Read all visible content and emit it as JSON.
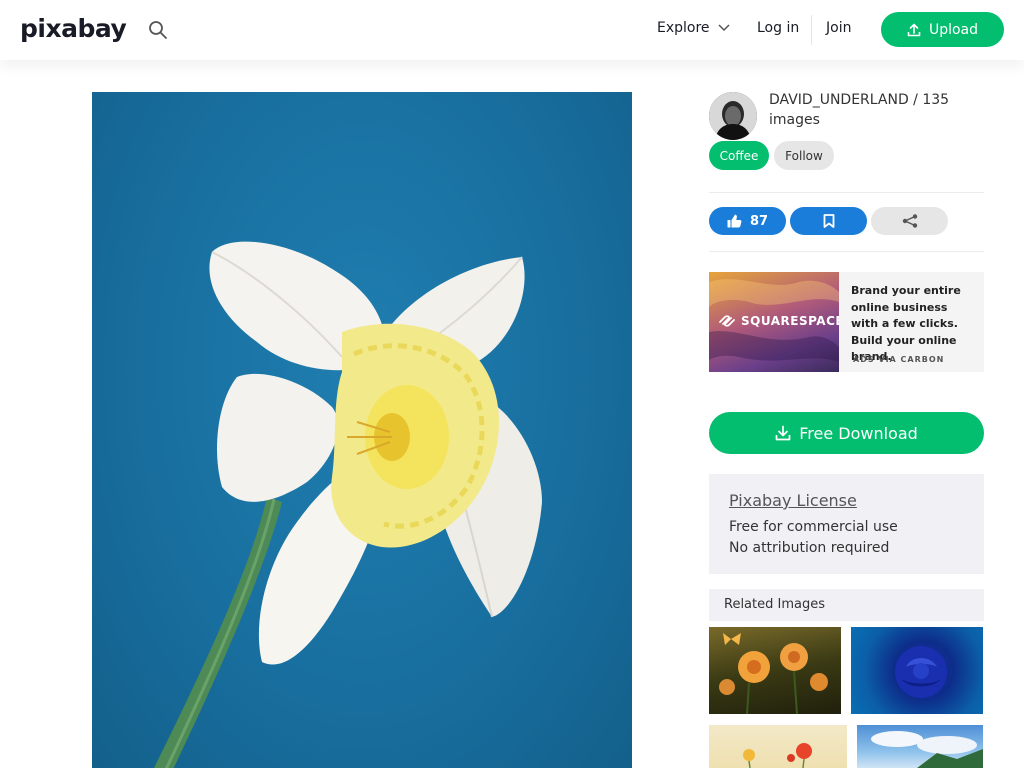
{
  "header": {
    "logo": "pixabay",
    "nav_explore": "Explore",
    "nav_login": "Log in",
    "nav_join": "Join",
    "upload_label": "Upload"
  },
  "author": {
    "name_line": "DAVID_UNDERLAND / 135 images",
    "coffee_label": "Coffee",
    "follow_label": "Follow"
  },
  "actions": {
    "like_count": "87"
  },
  "ad": {
    "brand": "SQUARESPACE",
    "text": "Brand your entire online business with a few clicks. Build your online brand.",
    "via": "ADS VIA CARBON"
  },
  "download": {
    "label": "Free Download"
  },
  "license": {
    "title": "Pixabay License",
    "line1": "Free for commercial use",
    "line2": "No attribution required"
  },
  "related": {
    "heading": "Related Images"
  },
  "colors": {
    "brand_green": "#02be6e",
    "action_blue": "#1a7dda",
    "photo_background": "#186f9f"
  }
}
